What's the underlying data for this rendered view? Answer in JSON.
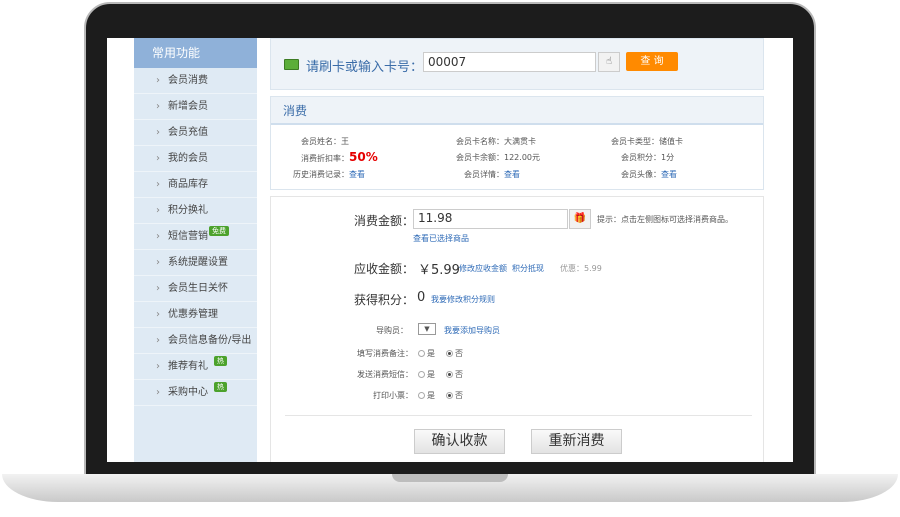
{
  "sidebar": {
    "title": "常用功能",
    "items": [
      {
        "label": "会员消费"
      },
      {
        "label": "新增会员"
      },
      {
        "label": "会员充值"
      },
      {
        "label": "我的会员"
      },
      {
        "label": "商品库存"
      },
      {
        "label": "积分换礼"
      },
      {
        "label": "短信营销",
        "badge": "免费"
      },
      {
        "label": "系统提醒设置"
      },
      {
        "label": "会员生日关怀"
      },
      {
        "label": "优惠券管理"
      },
      {
        "label": "会员信息备份/导出"
      },
      {
        "label": "推荐有礼",
        "badge": "热"
      },
      {
        "label": "采购中心",
        "badge": "热"
      }
    ]
  },
  "card": {
    "label": "请刷卡或输入卡号：",
    "value": "00007",
    "query_label": "查 询"
  },
  "section": {
    "title": "消费"
  },
  "info": {
    "name_label": "会员姓名：",
    "name": "王",
    "card_name_label": "会员卡名称：",
    "card_name": "大满贯卡",
    "card_type_label": "会员卡类型：",
    "card_type": "储值卡",
    "discount_label": "消费折扣率：",
    "discount": "50%",
    "balance_label": "会员卡余额：",
    "balance": "122.00元",
    "points_label": "会员积分：",
    "points": "1分",
    "history_label": "历史消费记录：",
    "history_link": "查看",
    "detail_label": "会员详情：",
    "detail_link": "查看",
    "avatar_label": "会员头像：",
    "avatar_link": "查看"
  },
  "form": {
    "amount_label": "消费金额：",
    "amount": "11.98",
    "hint": "提示：点击左侧图标可选择消费商品。",
    "view_selected": "查看已选择商品",
    "receivable_label": "应收金额：",
    "receivable": "￥5.99",
    "edit_receivable": "修改应收金额",
    "points_offset": "积分抵现",
    "discount_text": "优惠：5.99",
    "earn_label": "获得积分：",
    "earn": "0",
    "edit_rule": "我要修改积分规则",
    "guide_label": "导购员：",
    "add_guide": "我要添加导购员",
    "remark_label": "填写消费备注：",
    "sms_label": "发送消费短信：",
    "print_label": "打印小票：",
    "yes": "是",
    "no": "否",
    "confirm": "确认收款",
    "reset": "重新消费"
  }
}
